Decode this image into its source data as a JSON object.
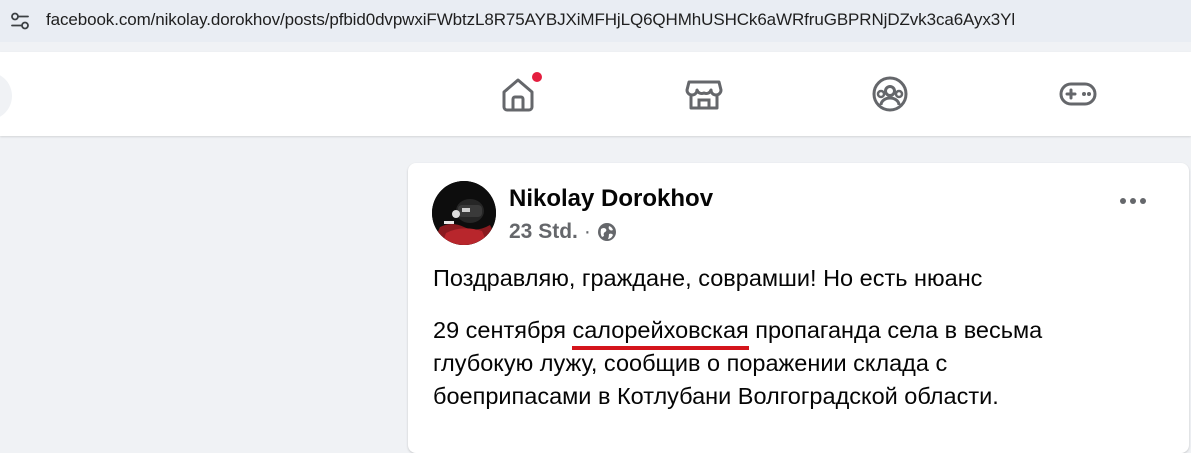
{
  "browser": {
    "url": "facebook.com/nikolay.dorokhov/posts/pfbid0dvpwxiFWbtzL8R75AYBJXiMFHjLQ6QHMhUSHCk6aWRfruGBPRNjDZvk3ca6Ayx3Yl",
    "url_icon": "site-settings-icon"
  },
  "navbar": {
    "items": [
      {
        "icon": "home-icon",
        "has_notification": true
      },
      {
        "icon": "marketplace-icon"
      },
      {
        "icon": "groups-icon"
      },
      {
        "icon": "gaming-icon"
      }
    ],
    "notification_color": "#e41e3f"
  },
  "post": {
    "author": "Nikolay Dorokhov",
    "time": "23 Std.",
    "separator": "·",
    "audience_icon": "globe-icon",
    "more_icon": "more-options-icon",
    "text_line1": "Поздравляю, граждане, соврамши! Но есть нюанс",
    "para2": {
      "before": "29 сентября ",
      "underlined": "салорейховская",
      "after": " пропаганда села в весьма",
      "line2": "глубокую лужу, сообщив о поражении склада с",
      "line3": "боеприпасами в Котлубани Волгоградской области."
    },
    "underline_color": "#d4151c"
  }
}
